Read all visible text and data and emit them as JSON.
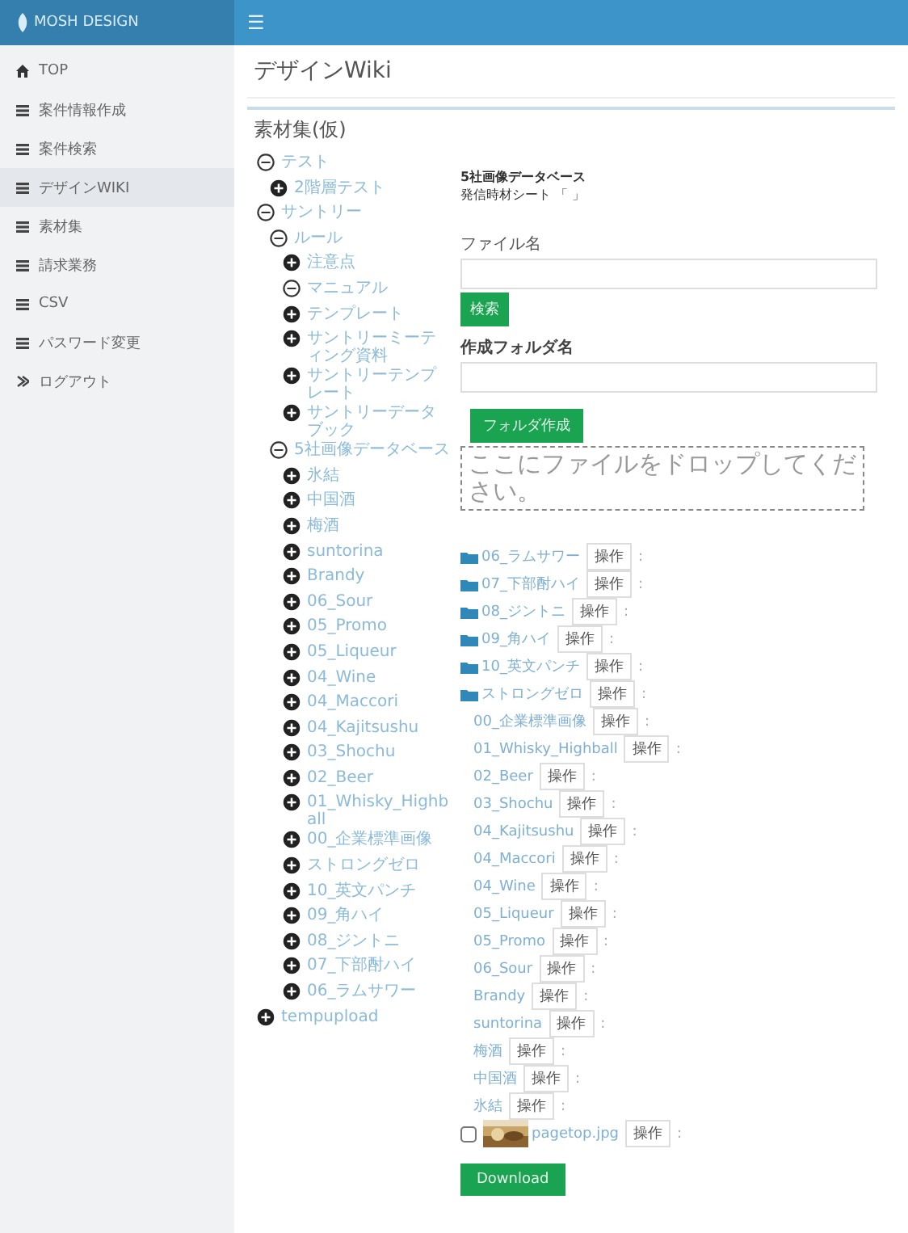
{
  "header": {
    "logo": "MOSH DESIGN",
    "menu_glyph": "☰"
  },
  "sidebar": {
    "items": [
      {
        "label": "TOP",
        "kind": "home",
        "selected": false
      },
      {
        "label": "案件情報作成",
        "kind": "page",
        "selected": false
      },
      {
        "label": "案件検索",
        "kind": "page",
        "selected": false
      },
      {
        "label": "デザインWIKI",
        "kind": "page",
        "selected": true
      },
      {
        "label": "素材集",
        "kind": "page",
        "selected": false
      },
      {
        "label": "請求業務",
        "kind": "page",
        "selected": false
      },
      {
        "label": "CSV",
        "kind": "page",
        "selected": false
      },
      {
        "label": "パスワード変更",
        "kind": "page",
        "selected": false
      },
      {
        "label": "ログアウト",
        "kind": "logout",
        "selected": false
      }
    ]
  },
  "page_title": "デザインWiki",
  "panel": {
    "title": "素材集(仮)",
    "tree": [
      {
        "label": "テスト",
        "expanded": true,
        "children": [
          {
            "label": "2階層テスト",
            "expanded": false
          }
        ]
      },
      {
        "label": "サントリー",
        "expanded": true,
        "children": [
          {
            "label": "ルール",
            "expanded": true,
            "children": [
              {
                "label": "注意点",
                "expanded": false
              },
              {
                "label": "マニュアル",
                "expanded": true
              },
              {
                "label": "テンプレート",
                "expanded": false
              },
              {
                "label": "サントリーミーティング資料",
                "expanded": false
              },
              {
                "label": "サントリーテンプレート",
                "expanded": false
              },
              {
                "label": "サントリーデータブック",
                "expanded": false
              }
            ]
          },
          {
            "label": "5社画像データベース",
            "expanded": true,
            "children": [
              {
                "label": "氷結",
                "expanded": false
              },
              {
                "label": "中国酒",
                "expanded": false
              },
              {
                "label": "梅酒",
                "expanded": false
              },
              {
                "label": "suntorina",
                "expanded": false
              },
              {
                "label": "Brandy",
                "expanded": false
              },
              {
                "label": "06_Sour",
                "expanded": false
              },
              {
                "label": "05_Promo",
                "expanded": false
              },
              {
                "label": "05_Liqueur",
                "expanded": false
              },
              {
                "label": "04_Wine",
                "expanded": false
              },
              {
                "label": "04_Maccori",
                "expanded": false
              },
              {
                "label": "04_Kajitsushu",
                "expanded": false
              },
              {
                "label": "03_Shochu",
                "expanded": false
              },
              {
                "label": "02_Beer",
                "expanded": false
              },
              {
                "label": "01_Whisky_Highball",
                "expanded": false
              },
              {
                "label": "00_企業標準画像",
                "expanded": false
              },
              {
                "label": "ストロングゼロ",
                "expanded": false
              },
              {
                "label": "10_英文パンチ",
                "expanded": false
              },
              {
                "label": "09_角ハイ",
                "expanded": false
              },
              {
                "label": "08_ジントニ",
                "expanded": false
              },
              {
                "label": "07_下部酎ハイ",
                "expanded": false
              },
              {
                "label": "06_ラムサワー",
                "expanded": false
              }
            ]
          }
        ]
      },
      {
        "label": "tempupload",
        "expanded": false
      }
    ],
    "path_title": "5社画像データベース",
    "path_sub": "発信時材シート 「 」",
    "file_label": "ファイル名",
    "search_button": "検索",
    "folder_label": "作成フォルダ名",
    "create_button": "フォルダ作成",
    "drop_text": "ここにファイルをドロップしてください。",
    "entries": [
      {
        "kind": "folder",
        "label": "06_ラムサワー",
        "action": "操作",
        "more": ":"
      },
      {
        "kind": "folder",
        "label": "07_下部酎ハイ",
        "action": "操作",
        "more": ":"
      },
      {
        "kind": "folder",
        "label": "08_ジントニ",
        "action": "操作",
        "more": ":"
      },
      {
        "kind": "folder",
        "label": "09_角ハイ",
        "action": "操作",
        "more": ":"
      },
      {
        "kind": "folder",
        "label": "10_英文パンチ",
        "action": "操作",
        "more": ":"
      },
      {
        "kind": "folder",
        "label": "ストロングゼロ",
        "action": "操作",
        "more": ":"
      },
      {
        "kind": "item",
        "label": "00_企業標準画像",
        "action": "操作",
        "more": ":"
      },
      {
        "kind": "item",
        "label": "01_Whisky_Highball",
        "action": "操作",
        "more": ":"
      },
      {
        "kind": "item",
        "label": "02_Beer",
        "action": "操作",
        "more": ":"
      },
      {
        "kind": "item",
        "label": "03_Shochu",
        "action": "操作",
        "more": ":"
      },
      {
        "kind": "item",
        "label": "04_Kajitsushu",
        "action": "操作",
        "more": ":"
      },
      {
        "kind": "item",
        "label": "04_Maccori",
        "action": "操作",
        "more": ":"
      },
      {
        "kind": "item",
        "label": "04_Wine",
        "action": "操作",
        "more": ":"
      },
      {
        "kind": "item",
        "label": "05_Liqueur",
        "action": "操作",
        "more": ":"
      },
      {
        "kind": "item",
        "label": "05_Promo",
        "action": "操作",
        "more": ":"
      },
      {
        "kind": "item",
        "label": "06_Sour",
        "action": "操作",
        "more": ":"
      },
      {
        "kind": "item",
        "label": "Brandy",
        "action": "操作",
        "more": ":"
      },
      {
        "kind": "item",
        "label": "suntorina",
        "action": "操作",
        "more": ":"
      },
      {
        "kind": "item",
        "label": "梅酒",
        "action": "操作",
        "more": ":"
      },
      {
        "kind": "item",
        "label": "中国酒",
        "action": "操作",
        "more": ":"
      },
      {
        "kind": "item",
        "label": "氷結",
        "action": "操作",
        "more": ":"
      },
      {
        "kind": "file",
        "label": "pagetop.jpg",
        "action": "操作",
        "more": ":",
        "checked": false
      }
    ],
    "download_button": "Download"
  }
}
